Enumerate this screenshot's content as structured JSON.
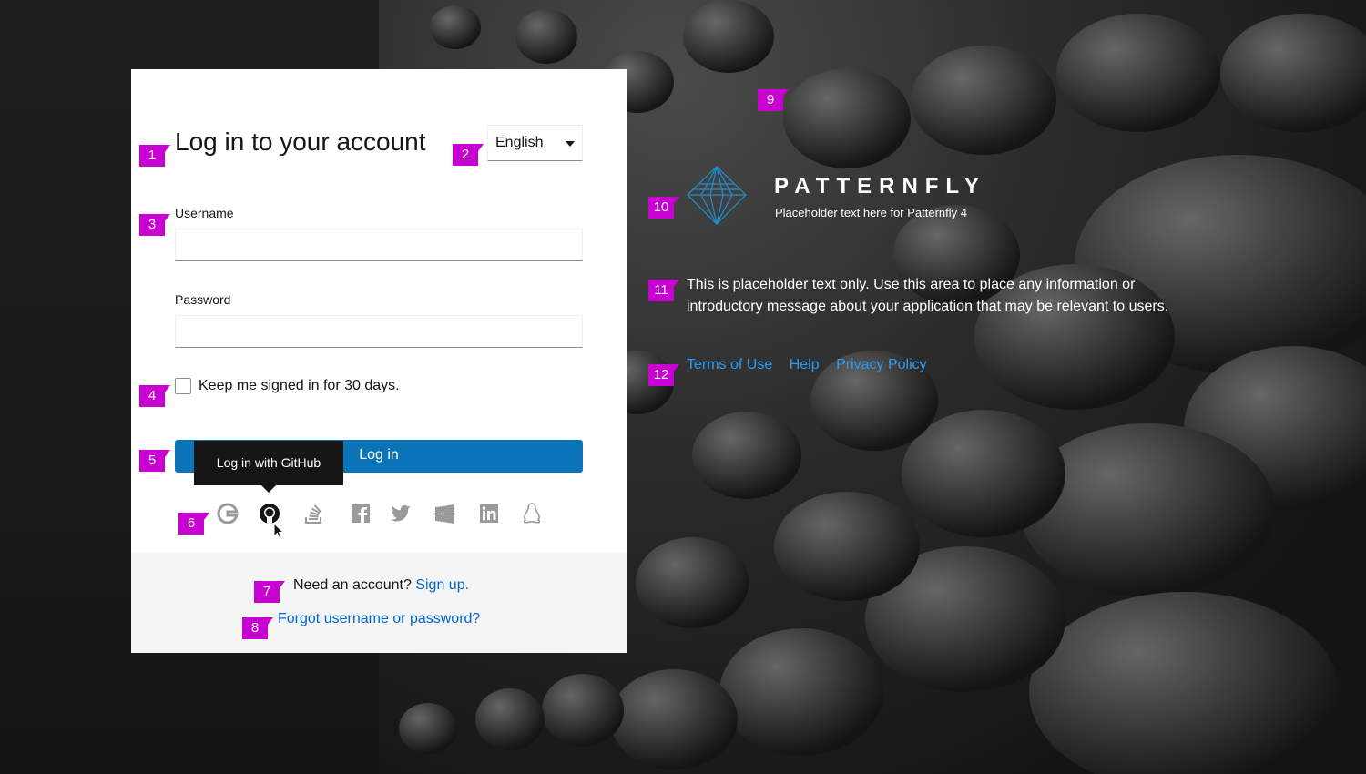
{
  "login": {
    "title": "Log in to your account",
    "language": "English",
    "username_label": "Username",
    "username_value": "",
    "password_label": "Password",
    "password_value": "",
    "remember_label": "Keep me signed in for 30 days.",
    "login_button": "Log in",
    "tooltip": "Log in with GitHub",
    "social_icons": [
      "google-icon",
      "github-icon",
      "stackoverflow-icon",
      "facebook-icon",
      "twitter-icon",
      "windows-icon",
      "linkedin-icon",
      "linux-icon"
    ],
    "signup_prefix": "Need an account?",
    "signup_link": "Sign up.",
    "forgot_link": "Forgot username or password?"
  },
  "brand": {
    "name": "PATTERNFLY",
    "subtitle": "Placeholder text here for Patternfly 4",
    "intro": "This is placeholder text only. Use this area to place any information or introductory message about your application that may be relevant to users.",
    "links": [
      "Terms of Use",
      "Help",
      "Privacy Policy"
    ]
  },
  "markers": [
    "1",
    "2",
    "3",
    "4",
    "5",
    "6",
    "7",
    "8",
    "9",
    "10",
    "11",
    "12"
  ],
  "colors": {
    "primary": "#0b74b8",
    "link": "#0066cc",
    "marker": "#c800d2",
    "brand_accent": "#1f8fd1"
  }
}
